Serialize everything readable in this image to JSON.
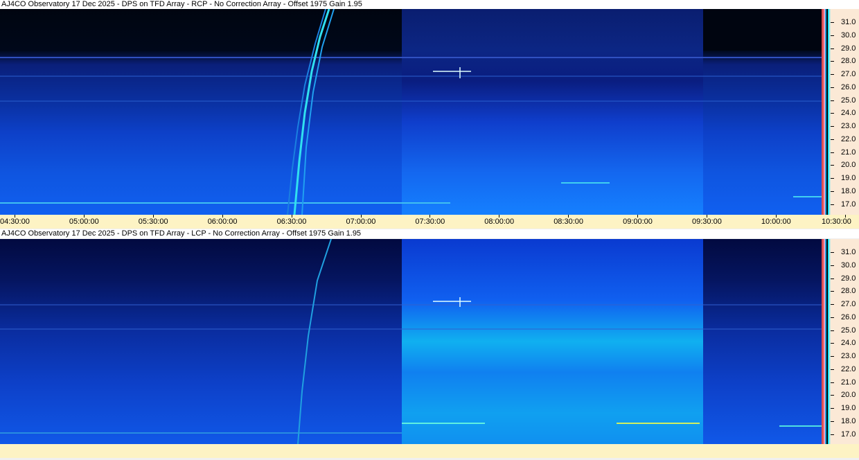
{
  "panels": [
    {
      "title": "AJ4CO Observatory 17 Dec 2025 - DPS on TFD Array  - RCP  -  No Correction Array  -  Offset 1975  Gain 1.95",
      "polarization": "RCP"
    },
    {
      "title": "AJ4CO Observatory 17 Dec 2025 - DPS on TFD Array  - LCP  -  No Correction Array  -  Offset 1975  Gain 1.95",
      "polarization": "LCP"
    }
  ],
  "time_labels": [
    "04:30:00",
    "05:00:00",
    "05:30:00",
    "06:00:00",
    "06:30:00",
    "07:00:00",
    "07:30:00",
    "08:00:00",
    "08:30:00",
    "09:00:00",
    "09:30:00",
    "10:00:00",
    "10:30:00"
  ],
  "freq_labels": [
    "31.0",
    "30.0",
    "29.0",
    "28.0",
    "27.0",
    "26.0",
    "25.0",
    "24.0",
    "23.0",
    "22.0",
    "21.0",
    "20.0",
    "19.0",
    "18.0",
    "17.0"
  ],
  "colors": {
    "dark": "#000814",
    "deep": "#0a1f8a",
    "blue": "#0f47e0",
    "bright": "#1580ff",
    "cyan": "#20e0f0",
    "axis_bg": "#fbe9d6",
    "time_bg": "#fdf3c4"
  },
  "chart_data": [
    {
      "type": "heatmap",
      "title": "AJ4CO Observatory 17 Dec 2025 - DPS on TFD Array  - RCP  -  No Correction Array  -  Offset 1975  Gain 1.95",
      "x": {
        "start": "04:30:00",
        "end": "10:30:00",
        "ticks": [
          "04:30:00",
          "05:00:00",
          "05:30:00",
          "06:00:00",
          "06:30:00",
          "07:00:00",
          "07:30:00",
          "08:00:00",
          "08:30:00",
          "09:00:00",
          "09:30:00",
          "10:00:00",
          "10:30:00"
        ]
      },
      "y": {
        "range_MHz": [
          16.5,
          31.7
        ],
        "ticks": [
          31.0,
          30.0,
          29.0,
          28.0,
          27.0,
          26.0,
          25.0,
          24.0,
          23.0,
          22.0,
          21.0,
          20.0,
          19.0,
          18.0,
          17.0
        ]
      },
      "features": [
        "Jupiter decametric burst ~06:40–06:58, drifting from ~17 MHz up to >31 MHz",
        "Brighter gain segment ~07:24–09:33"
      ]
    },
    {
      "type": "heatmap",
      "title": "AJ4CO Observatory 17 Dec 2025 - DPS on TFD Array  - LCP  -  No Correction Array  -  Offset 1975  Gain 1.95",
      "x": {
        "start": "04:30:00",
        "end": "10:30:00"
      },
      "y": {
        "range_MHz": [
          16.5,
          31.7
        ],
        "ticks": [
          31.0,
          30.0,
          29.0,
          28.0,
          27.0,
          26.0,
          25.0,
          24.0,
          23.0,
          22.0,
          21.0,
          20.0,
          19.0,
          18.0,
          17.0
        ]
      }
    }
  ]
}
